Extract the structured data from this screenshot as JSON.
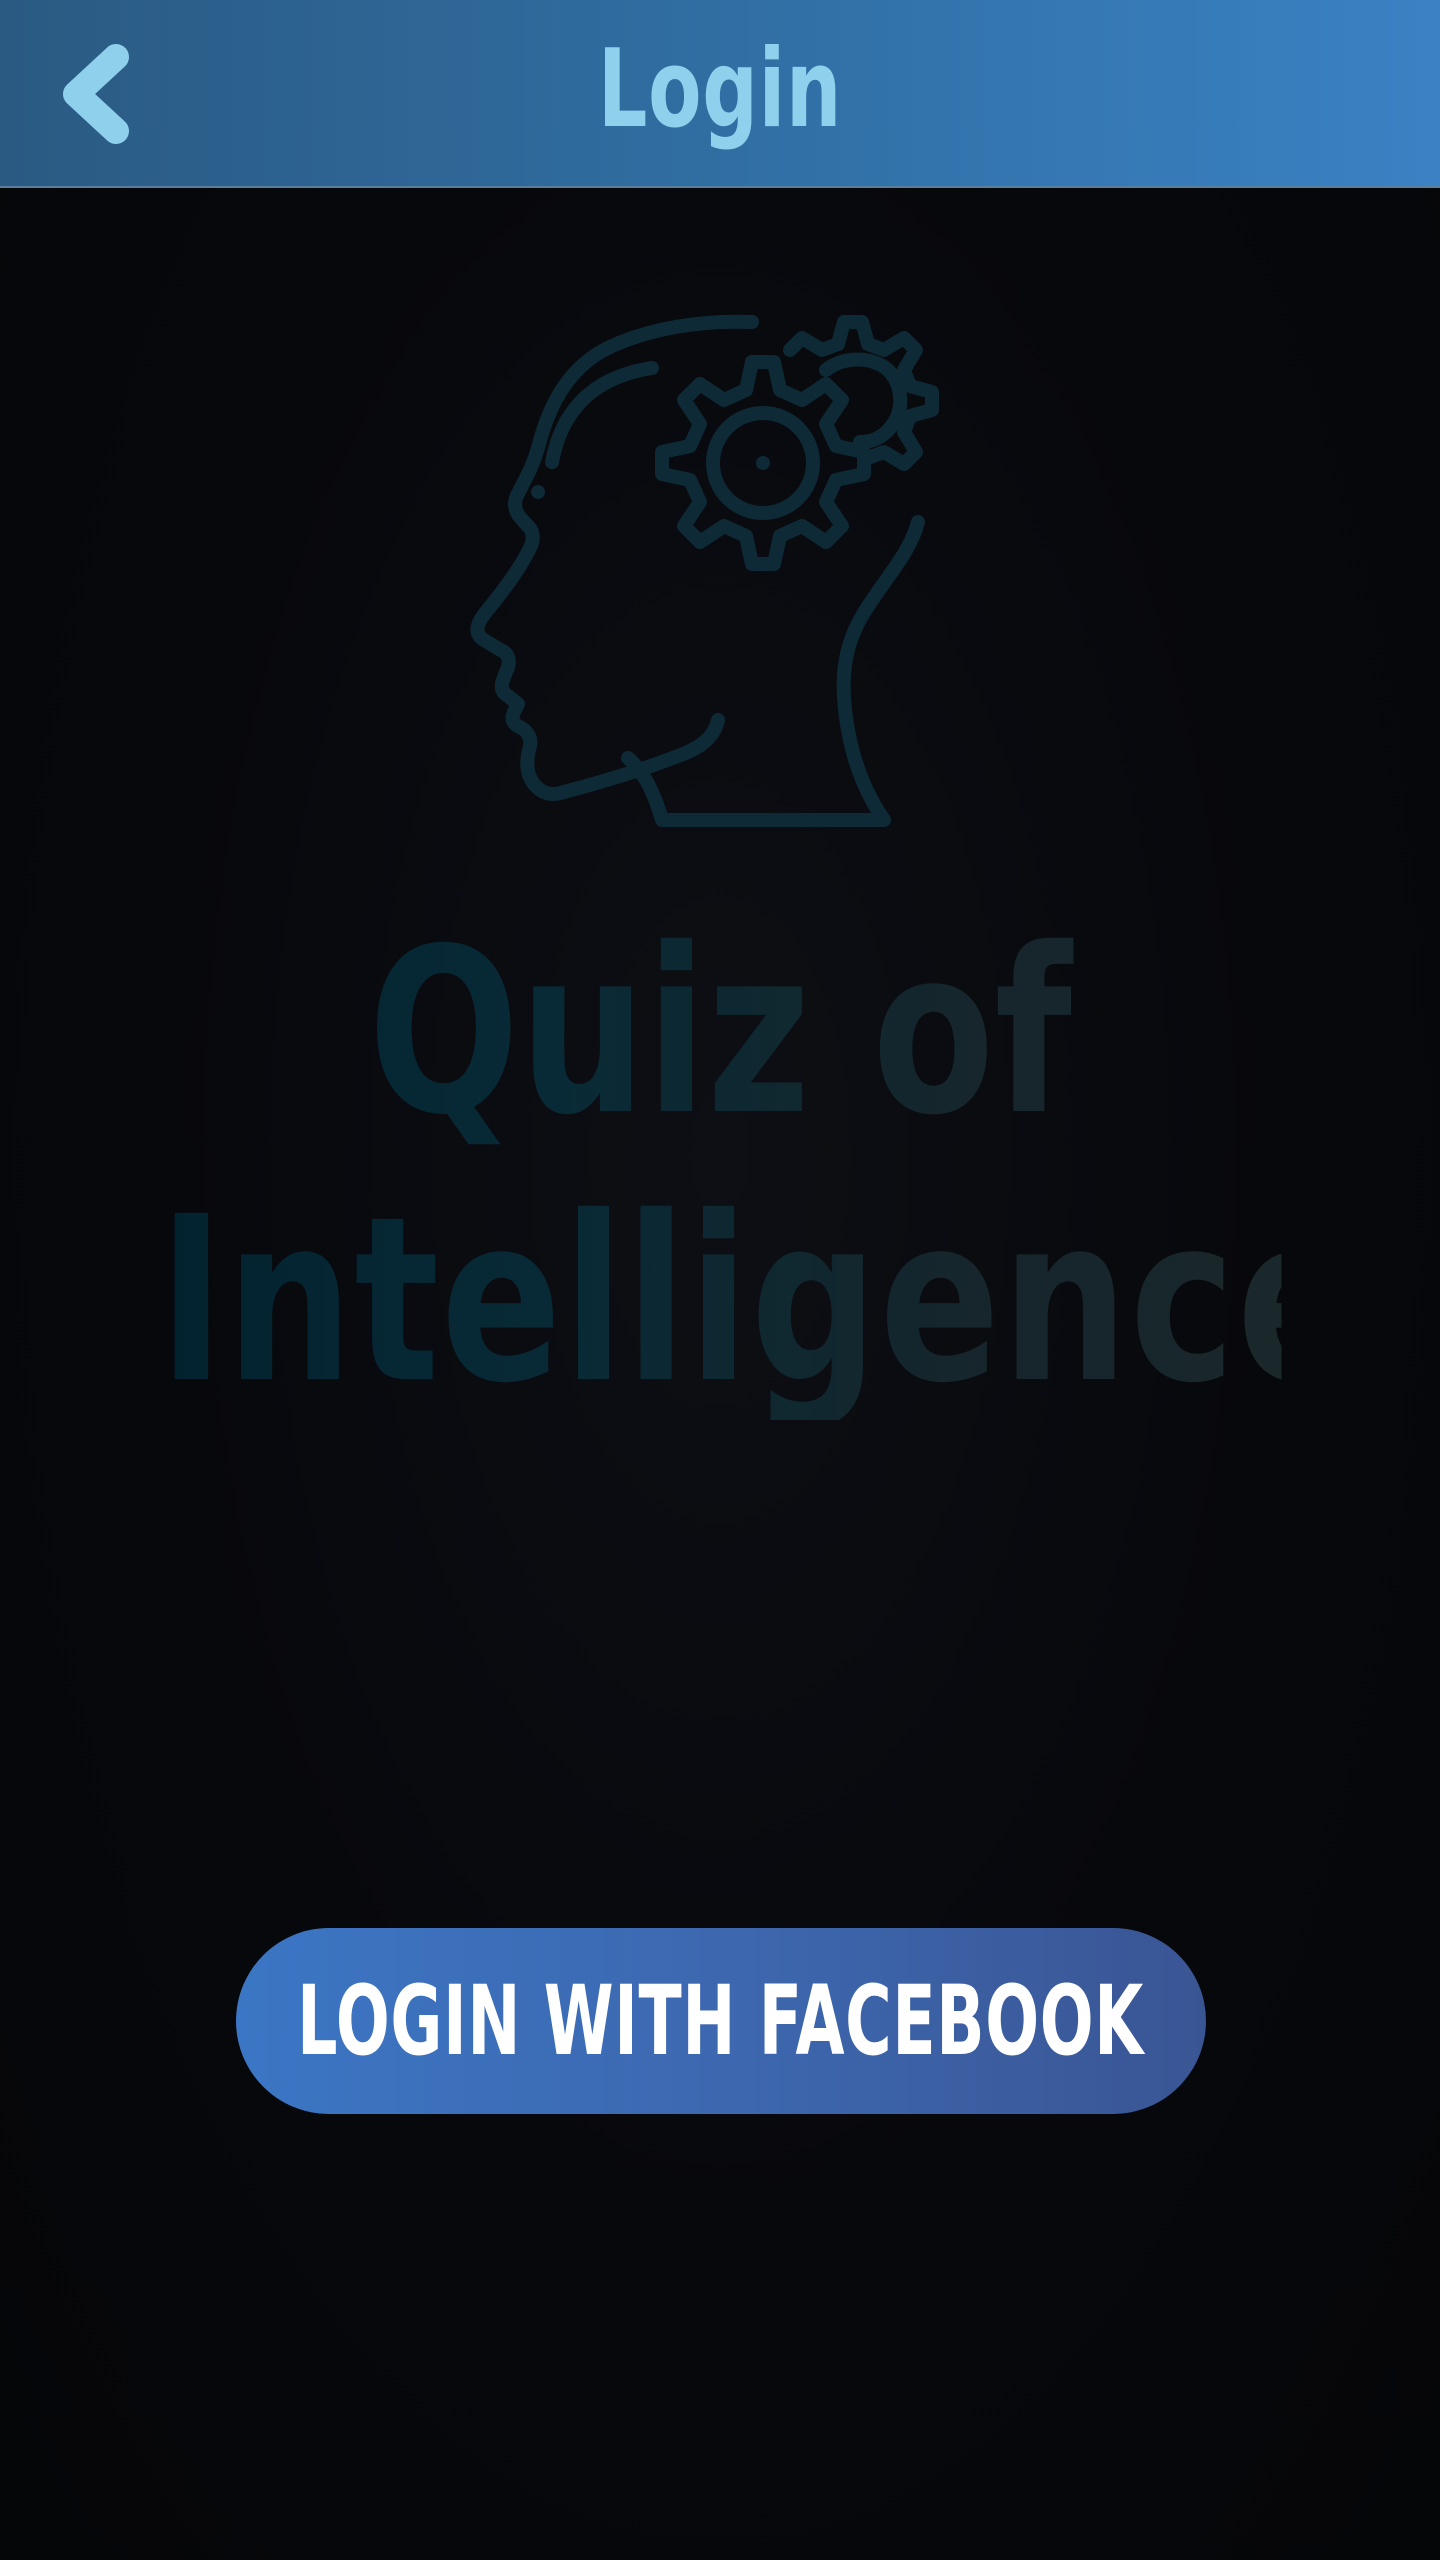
{
  "header": {
    "title": "Login",
    "back_icon": "chevron-left-icon",
    "background_start": "#2a5a82",
    "background_end": "#3a82c4",
    "title_color": "#8fd0ec"
  },
  "logo": {
    "icon": "brain-gear-head-icon",
    "stroke_color": "#0e2a36"
  },
  "app_title": {
    "line1": "Quiz of",
    "line2": "Intelligence",
    "color": "#0c2833"
  },
  "login_button": {
    "label": "LOGIN WITH FACEBOOK",
    "background_start": "#3b76c4",
    "background_end": "#3a5594",
    "text_color": "#ffffff"
  }
}
